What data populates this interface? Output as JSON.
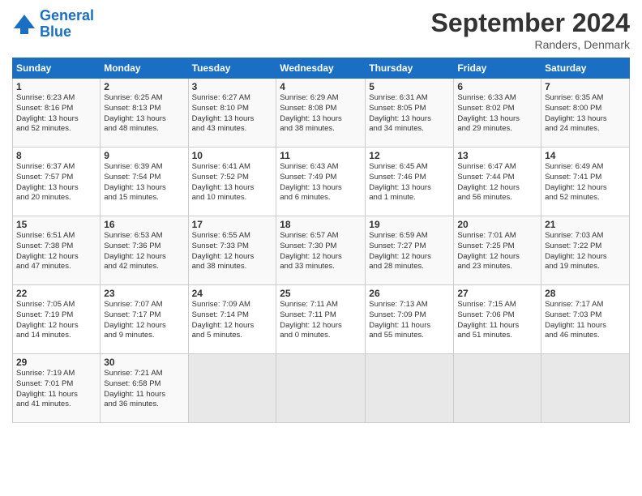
{
  "header": {
    "logo_line1": "General",
    "logo_line2": "Blue",
    "month_title": "September 2024",
    "location": "Randers, Denmark"
  },
  "weekdays": [
    "Sunday",
    "Monday",
    "Tuesday",
    "Wednesday",
    "Thursday",
    "Friday",
    "Saturday"
  ],
  "weeks": [
    [
      {
        "day": "1",
        "info": "Sunrise: 6:23 AM\nSunset: 8:16 PM\nDaylight: 13 hours\nand 52 minutes."
      },
      {
        "day": "2",
        "info": "Sunrise: 6:25 AM\nSunset: 8:13 PM\nDaylight: 13 hours\nand 48 minutes."
      },
      {
        "day": "3",
        "info": "Sunrise: 6:27 AM\nSunset: 8:10 PM\nDaylight: 13 hours\nand 43 minutes."
      },
      {
        "day": "4",
        "info": "Sunrise: 6:29 AM\nSunset: 8:08 PM\nDaylight: 13 hours\nand 38 minutes."
      },
      {
        "day": "5",
        "info": "Sunrise: 6:31 AM\nSunset: 8:05 PM\nDaylight: 13 hours\nand 34 minutes."
      },
      {
        "day": "6",
        "info": "Sunrise: 6:33 AM\nSunset: 8:02 PM\nDaylight: 13 hours\nand 29 minutes."
      },
      {
        "day": "7",
        "info": "Sunrise: 6:35 AM\nSunset: 8:00 PM\nDaylight: 13 hours\nand 24 minutes."
      }
    ],
    [
      {
        "day": "8",
        "info": "Sunrise: 6:37 AM\nSunset: 7:57 PM\nDaylight: 13 hours\nand 20 minutes."
      },
      {
        "day": "9",
        "info": "Sunrise: 6:39 AM\nSunset: 7:54 PM\nDaylight: 13 hours\nand 15 minutes."
      },
      {
        "day": "10",
        "info": "Sunrise: 6:41 AM\nSunset: 7:52 PM\nDaylight: 13 hours\nand 10 minutes."
      },
      {
        "day": "11",
        "info": "Sunrise: 6:43 AM\nSunset: 7:49 PM\nDaylight: 13 hours\nand 6 minutes."
      },
      {
        "day": "12",
        "info": "Sunrise: 6:45 AM\nSunset: 7:46 PM\nDaylight: 13 hours\nand 1 minute."
      },
      {
        "day": "13",
        "info": "Sunrise: 6:47 AM\nSunset: 7:44 PM\nDaylight: 12 hours\nand 56 minutes."
      },
      {
        "day": "14",
        "info": "Sunrise: 6:49 AM\nSunset: 7:41 PM\nDaylight: 12 hours\nand 52 minutes."
      }
    ],
    [
      {
        "day": "15",
        "info": "Sunrise: 6:51 AM\nSunset: 7:38 PM\nDaylight: 12 hours\nand 47 minutes."
      },
      {
        "day": "16",
        "info": "Sunrise: 6:53 AM\nSunset: 7:36 PM\nDaylight: 12 hours\nand 42 minutes."
      },
      {
        "day": "17",
        "info": "Sunrise: 6:55 AM\nSunset: 7:33 PM\nDaylight: 12 hours\nand 38 minutes."
      },
      {
        "day": "18",
        "info": "Sunrise: 6:57 AM\nSunset: 7:30 PM\nDaylight: 12 hours\nand 33 minutes."
      },
      {
        "day": "19",
        "info": "Sunrise: 6:59 AM\nSunset: 7:27 PM\nDaylight: 12 hours\nand 28 minutes."
      },
      {
        "day": "20",
        "info": "Sunrise: 7:01 AM\nSunset: 7:25 PM\nDaylight: 12 hours\nand 23 minutes."
      },
      {
        "day": "21",
        "info": "Sunrise: 7:03 AM\nSunset: 7:22 PM\nDaylight: 12 hours\nand 19 minutes."
      }
    ],
    [
      {
        "day": "22",
        "info": "Sunrise: 7:05 AM\nSunset: 7:19 PM\nDaylight: 12 hours\nand 14 minutes."
      },
      {
        "day": "23",
        "info": "Sunrise: 7:07 AM\nSunset: 7:17 PM\nDaylight: 12 hours\nand 9 minutes."
      },
      {
        "day": "24",
        "info": "Sunrise: 7:09 AM\nSunset: 7:14 PM\nDaylight: 12 hours\nand 5 minutes."
      },
      {
        "day": "25",
        "info": "Sunrise: 7:11 AM\nSunset: 7:11 PM\nDaylight: 12 hours\nand 0 minutes."
      },
      {
        "day": "26",
        "info": "Sunrise: 7:13 AM\nSunset: 7:09 PM\nDaylight: 11 hours\nand 55 minutes."
      },
      {
        "day": "27",
        "info": "Sunrise: 7:15 AM\nSunset: 7:06 PM\nDaylight: 11 hours\nand 51 minutes."
      },
      {
        "day": "28",
        "info": "Sunrise: 7:17 AM\nSunset: 7:03 PM\nDaylight: 11 hours\nand 46 minutes."
      }
    ],
    [
      {
        "day": "29",
        "info": "Sunrise: 7:19 AM\nSunset: 7:01 PM\nDaylight: 11 hours\nand 41 minutes."
      },
      {
        "day": "30",
        "info": "Sunrise: 7:21 AM\nSunset: 6:58 PM\nDaylight: 11 hours\nand 36 minutes."
      },
      {
        "day": "",
        "info": ""
      },
      {
        "day": "",
        "info": ""
      },
      {
        "day": "",
        "info": ""
      },
      {
        "day": "",
        "info": ""
      },
      {
        "day": "",
        "info": ""
      }
    ]
  ]
}
